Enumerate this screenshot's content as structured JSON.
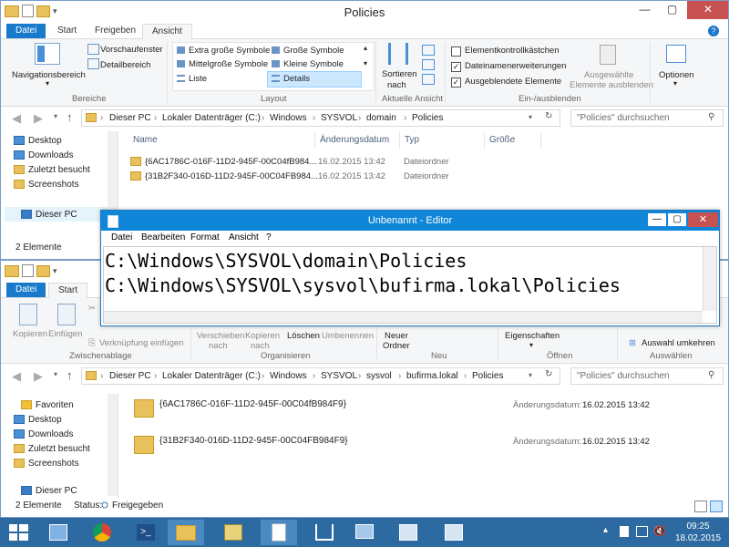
{
  "window1": {
    "title": "Policies",
    "tabs": [
      "Datei",
      "Start",
      "Freigeben",
      "Ansicht"
    ],
    "ribbon": {
      "nav_pane": "Navigationsbereich",
      "preview_pane": "Vorschaufenster",
      "details_pane": "Detailbereich",
      "group_panes": "Bereiche",
      "layout_items": [
        "Extra große Symbole",
        "Große Symbole",
        "Mittelgroße Symbole",
        "Kleine Symbole",
        "Liste",
        "Details"
      ],
      "group_layout": "Layout",
      "sort": "Sortieren",
      "sort2": "nach",
      "group_current_view": "Aktuelle Ansicht",
      "chk_item_checkboxes": "Elementkontrollkästchen",
      "chk_extensions": "Dateinamenerweiterungen",
      "chk_hidden": "Ausgeblendete Elemente",
      "hide_selected_1": "Ausgewählte",
      "hide_selected_2": "Elemente ausblenden",
      "options": "Optionen",
      "group_show_hide": "Ein-/ausblenden"
    },
    "address": [
      "Dieser PC",
      "Lokaler Datenträger (C:)",
      "Windows",
      "SYSVOL",
      "domain",
      "Policies"
    ],
    "search_placeholder": "\"Policies\" durchsuchen",
    "nav": [
      "Desktop",
      "Downloads",
      "Zuletzt besucht",
      "Screenshots",
      "Dieser PC"
    ],
    "columns": [
      "Name",
      "Änderungsdatum",
      "Typ",
      "Größe"
    ],
    "rows": [
      {
        "name": "{6AC1786C-016F-11D2-945F-00C04fB984...",
        "date": "16.02.2015 13:42",
        "type": "Dateiordner"
      },
      {
        "name": "{31B2F340-016D-11D2-945F-00C04FB984...",
        "date": "16.02.2015 13:42",
        "type": "Dateiordner"
      }
    ],
    "status": "2 Elemente"
  },
  "notepad": {
    "title": "Unbenannt - Editor",
    "menu": [
      "Datei",
      "Bearbeiten",
      "Format",
      "Ansicht",
      "?"
    ],
    "line1": "C:\\Windows\\SYSVOL\\domain\\Policies",
    "line2": "C:\\Windows\\SYSVOL\\sysvol\\bufirma.lokal\\Policies"
  },
  "window2": {
    "tabs": [
      "Datei",
      "Start"
    ],
    "ribbon": {
      "copy": "Kopieren",
      "paste": "Einfügen",
      "paste_link": "Verknüpfung einfügen",
      "group_clipboard": "Zwischenablage",
      "move_to_1": "Verschieben",
      "move_to_2": "nach",
      "copy_to_1": "Kopieren",
      "copy_to_2": "nach",
      "delete": "Löschen",
      "rename": "Umbenennen",
      "group_organize": "Organisieren",
      "new_folder_1": "Neuer",
      "new_folder_2": "Ordner",
      "group_new": "Neu",
      "properties": "Eigenschaften",
      "group_open": "Öffnen",
      "invert_selection": "Auswahl umkehren",
      "group_select": "Auswählen"
    },
    "address": [
      "Dieser PC",
      "Lokaler Datenträger (C:)",
      "Windows",
      "SYSVOL",
      "sysvol",
      "bufirma.lokal",
      "Policies"
    ],
    "search_placeholder": "\"Policies\" durchsuchen",
    "nav": [
      "Favoriten",
      "Desktop",
      "Downloads",
      "Zuletzt besucht",
      "Screenshots",
      "Dieser PC"
    ],
    "tiles": [
      {
        "name": "{6AC1786C-016F-11D2-945F-00C04fB984F9}",
        "date_label": "Änderungsdatum:",
        "date": "16.02.2015 13:42"
      },
      {
        "name": "{31B2F340-016D-11D2-945F-00C04FB984F9}",
        "date_label": "Änderungsdatum:",
        "date": "16.02.2015 13:42"
      }
    ],
    "status": "2 Elemente",
    "status_label": "Status:",
    "status_value": "Freigegeben"
  },
  "taskbar": {
    "time": "09:25",
    "date": "18.02.2015"
  }
}
